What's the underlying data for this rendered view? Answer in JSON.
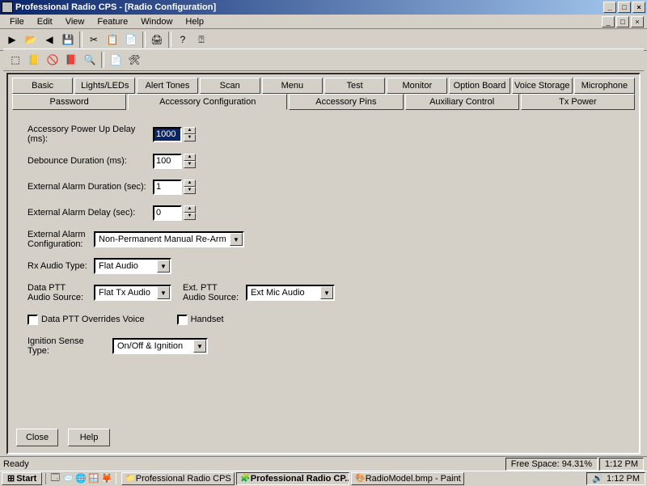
{
  "window": {
    "title": "Professional Radio CPS - [Radio Configuration]"
  },
  "menu": {
    "file": "File",
    "edit": "Edit",
    "view": "View",
    "feature": "Feature",
    "window": "Window",
    "help": "Help"
  },
  "tabs_row1": {
    "basic": "Basic",
    "lights": "Lights/LEDs",
    "alert": "Alert Tones",
    "scan": "Scan",
    "menu": "Menu",
    "test": "Test",
    "monitor": "Monitor",
    "option": "Option Board",
    "voice": "Voice Storage",
    "mic": "Microphone"
  },
  "tabs_row2": {
    "password": "Password",
    "acc_config": "Accessory Configuration",
    "acc_pins": "Accessory Pins",
    "aux": "Auxiliary Control",
    "tx": "Tx Power"
  },
  "form": {
    "power_up_delay_label": "Accessory Power Up Delay (ms):",
    "power_up_delay_value": "1000",
    "debounce_label": "Debounce Duration (ms):",
    "debounce_value": "100",
    "ext_alarm_dur_label": "External Alarm Duration (sec):",
    "ext_alarm_dur_value": "1",
    "ext_alarm_delay_label": "External Alarm Delay (sec):",
    "ext_alarm_delay_value": "0",
    "ext_alarm_cfg_label": "External Alarm Configuration:",
    "ext_alarm_cfg_value": "Non-Permanent Manual Re-Arm",
    "rx_audio_label": "Rx Audio Type:",
    "rx_audio_value": "Flat Audio",
    "data_ptt_label": "Data PTT Audio Source:",
    "data_ptt_value": "Flat Tx Audio",
    "ext_ptt_label": "Ext. PTT Audio Source:",
    "ext_ptt_value": "Ext Mic Audio",
    "data_ptt_override": "Data PTT Overrides Voice",
    "handset": "Handset",
    "ignition_label": "Ignition Sense Type:",
    "ignition_value": "On/Off & Ignition"
  },
  "buttons": {
    "close": "Close",
    "help": "Help"
  },
  "status": {
    "ready": "Ready",
    "free_space": "Free Space: 94.31%",
    "time1": "1:12 PM"
  },
  "taskbar": {
    "start": "Start",
    "task1": "Professional Radio CPS R...",
    "task2": "Professional Radio CP...",
    "task3": "RadioModel.bmp - Paint",
    "time": "1:12 PM"
  }
}
